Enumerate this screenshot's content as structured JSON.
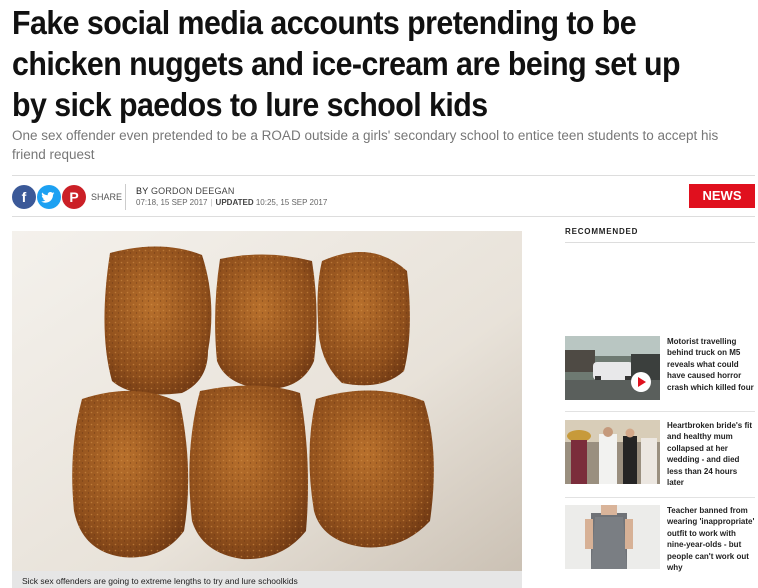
{
  "article": {
    "headline": "Fake social media accounts pretending to be chicken nuggets and ice-cream are being set up by sick paedos to lure school kids",
    "standfirst": "One sex offender even pretended to be a ROAD outside a girls' secondary school to entice teen students to accept his friend request",
    "share_label": "SHARE",
    "byline_prefix": "BY",
    "author": "GORDON DEEGAN",
    "published": "07:18, 15 SEP 2017",
    "updated_label": "UPDATED",
    "updated": "10:25, 15 SEP 2017",
    "section_tag": "NEWS",
    "image_caption": "Sick sex offenders are going to extreme lengths to try and lure schoolkids"
  },
  "share_icons": [
    "facebook-icon",
    "twitter-icon",
    "pinterest-icon"
  ],
  "sidebar": {
    "title": "RECOMMENDED",
    "items": [
      {
        "text": "Motorist travelling behind truck on M5 reveals what could have caused horror crash which killed four",
        "has_video": true
      },
      {
        "text": "Heartbroken bride's fit and healthy mum collapsed at her wedding - and died less than 24 hours later",
        "has_video": false
      },
      {
        "text": "Teacher banned from wearing 'inappropriate' outfit to work with nine-year-olds - but people can't work out why",
        "has_video": false
      }
    ]
  },
  "colors": {
    "brand_red": "#e0101e",
    "facebook": "#3b5998",
    "twitter": "#1da1f2",
    "pinterest": "#cb2027"
  }
}
